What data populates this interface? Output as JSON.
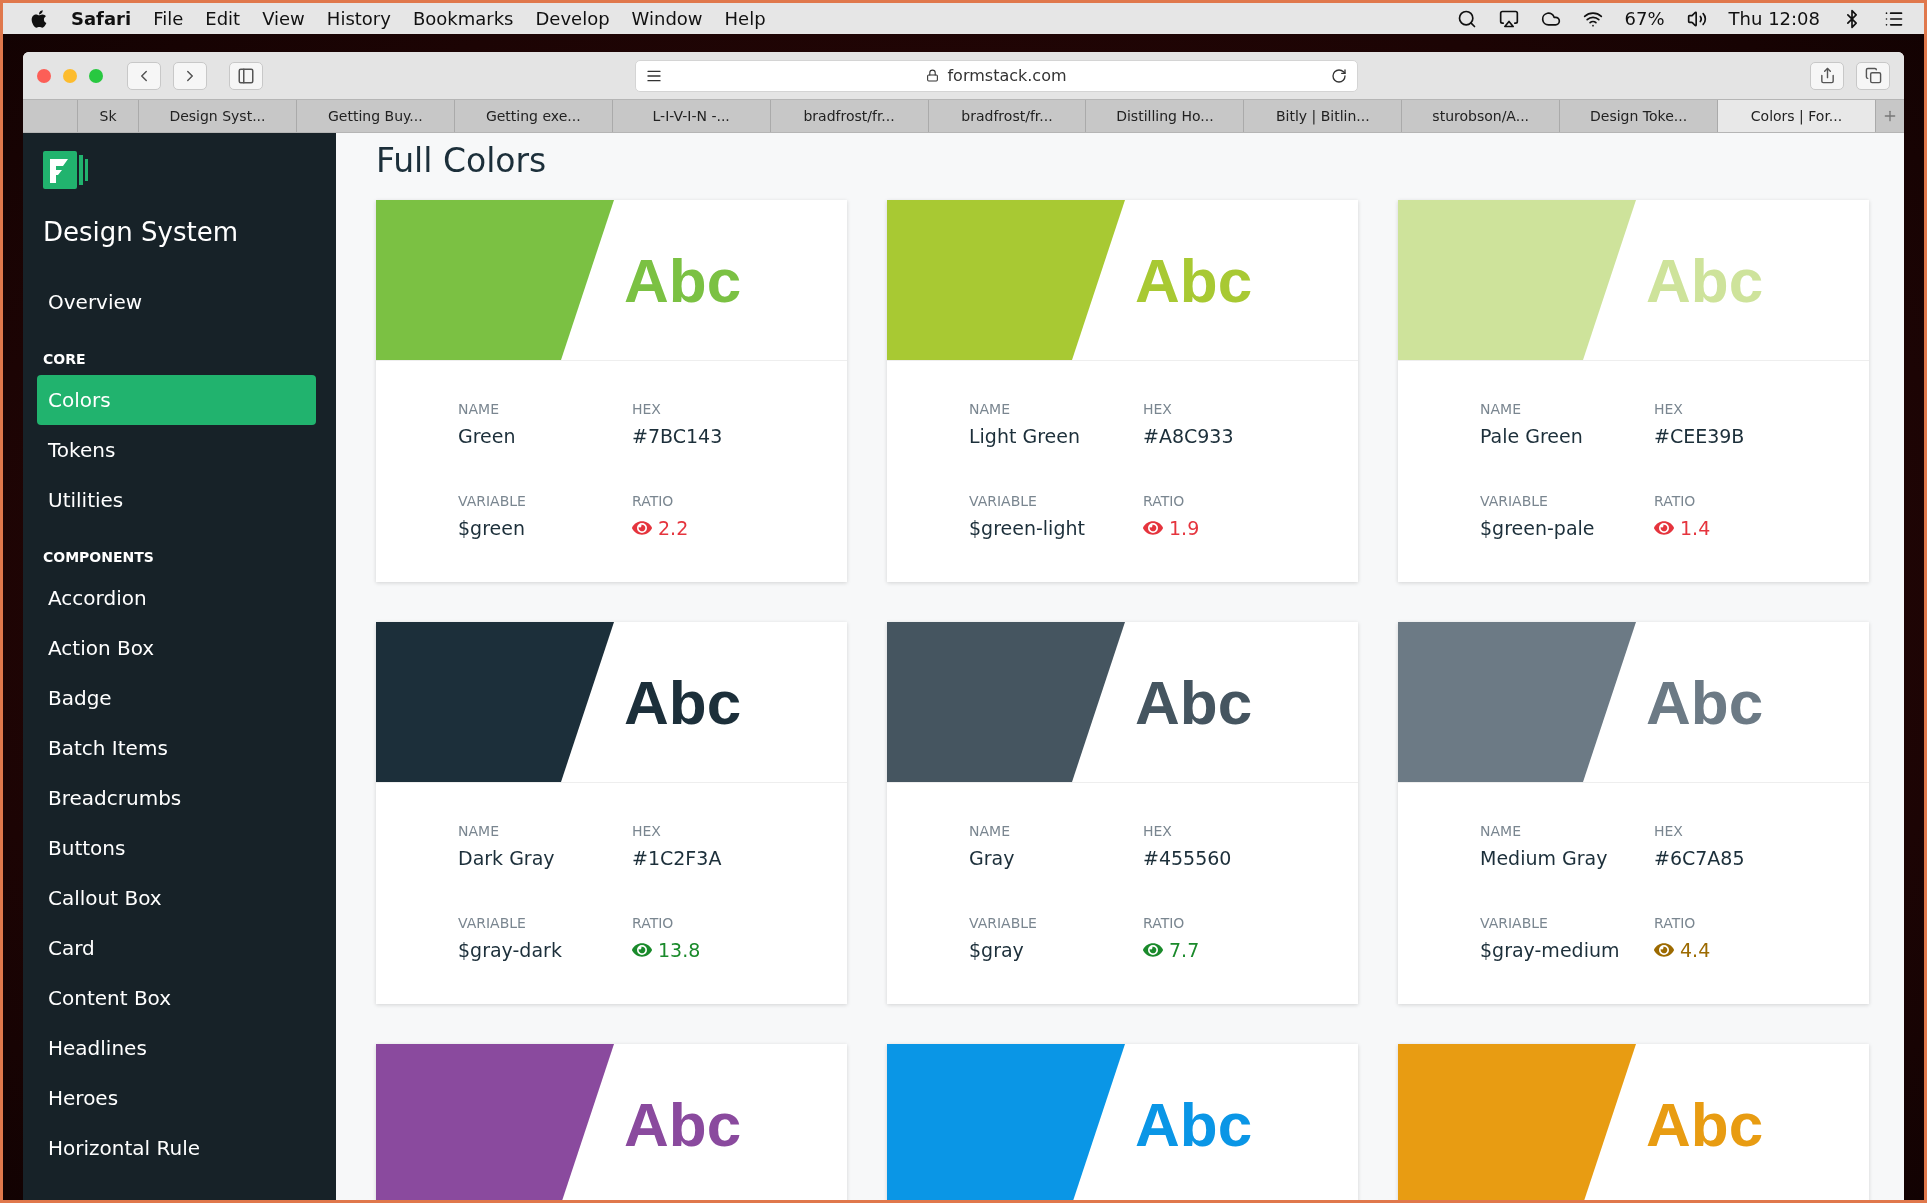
{
  "menubar": {
    "app": "Safari",
    "items": [
      "File",
      "Edit",
      "View",
      "History",
      "Bookmarks",
      "Develop",
      "Window",
      "Help"
    ],
    "battery": "67%",
    "clock": "Thu 12:08"
  },
  "browser": {
    "url": "formstack.com",
    "tabs": [
      {
        "label": "Sk",
        "selected": false
      },
      {
        "label": "Design Syst...",
        "selected": false
      },
      {
        "label": "Getting Buy...",
        "selected": false
      },
      {
        "label": "Getting exe...",
        "selected": false
      },
      {
        "label": "L-I-V-I-N -...",
        "selected": false
      },
      {
        "label": "bradfrost/fr...",
        "selected": false
      },
      {
        "label": "bradfrost/fr...",
        "selected": false
      },
      {
        "label": "Distilling Ho...",
        "selected": false
      },
      {
        "label": "Bitly | Bitlin...",
        "selected": false
      },
      {
        "label": "sturobson/A...",
        "selected": false
      },
      {
        "label": "Design Toke...",
        "selected": false
      },
      {
        "label": "Colors | For...",
        "selected": true
      }
    ]
  },
  "sidebar": {
    "title": "Design System",
    "sections": [
      {
        "items": [
          {
            "label": "Overview",
            "selected": false
          }
        ]
      },
      {
        "heading": "CORE",
        "items": [
          {
            "label": "Colors",
            "selected": true
          },
          {
            "label": "Tokens",
            "selected": false
          },
          {
            "label": "Utilities",
            "selected": false
          }
        ]
      },
      {
        "heading": "COMPONENTS",
        "items": [
          {
            "label": "Accordion",
            "selected": false
          },
          {
            "label": "Action Box",
            "selected": false
          },
          {
            "label": "Badge",
            "selected": false
          },
          {
            "label": "Batch Items",
            "selected": false
          },
          {
            "label": "Breadcrumbs",
            "selected": false
          },
          {
            "label": "Buttons",
            "selected": false
          },
          {
            "label": "Callout Box",
            "selected": false
          },
          {
            "label": "Card",
            "selected": false
          },
          {
            "label": "Content Box",
            "selected": false
          },
          {
            "label": "Headlines",
            "selected": false
          },
          {
            "label": "Heroes",
            "selected": false
          },
          {
            "label": "Horizontal Rule",
            "selected": false
          }
        ]
      }
    ]
  },
  "page": {
    "title": "Full Colors",
    "cards": [
      {
        "color": "#7bc143",
        "sample": "Abc",
        "name_label": "NAME",
        "name": "Green",
        "hex_label": "HEX",
        "hex": "#7BC143",
        "variable_label": "VARIABLE",
        "variable": "$green",
        "ratio_label": "RATIO",
        "ratio": {
          "value": "2.2",
          "color": "#e5343d"
        }
      },
      {
        "color": "#a8c933",
        "sample": "Abc",
        "name_label": "NAME",
        "name": "Light Green",
        "hex_label": "HEX",
        "hex": "#A8C933",
        "variable_label": "VARIABLE",
        "variable": "$green-light",
        "ratio_label": "RATIO",
        "ratio": {
          "value": "1.9",
          "color": "#e5343d"
        }
      },
      {
        "color": "#cee39b",
        "sample": "Abc",
        "name_label": "NAME",
        "name": "Pale Green",
        "hex_label": "HEX",
        "hex": "#CEE39B",
        "variable_label": "VARIABLE",
        "variable": "$green-pale",
        "ratio_label": "RATIO",
        "ratio": {
          "value": "1.4",
          "color": "#e5343d"
        }
      },
      {
        "color": "#1c2f3a",
        "sample": "Abc",
        "name_label": "NAME",
        "name": "Dark Gray",
        "hex_label": "HEX",
        "hex": "#1C2F3A",
        "variable_label": "VARIABLE",
        "variable": "$gray-dark",
        "ratio_label": "RATIO",
        "ratio": {
          "value": "13.8",
          "color": "#1a8a2b"
        }
      },
      {
        "color": "#455560",
        "sample": "Abc",
        "name_label": "NAME",
        "name": "Gray",
        "hex_label": "HEX",
        "hex": "#455560",
        "variable_label": "VARIABLE",
        "variable": "$gray",
        "ratio_label": "RATIO",
        "ratio": {
          "value": "7.7",
          "color": "#1a8a2b"
        }
      },
      {
        "color": "#6c7a85",
        "sample": "Abc",
        "name_label": "NAME",
        "name": "Medium Gray",
        "hex_label": "HEX",
        "hex": "#6C7A85",
        "variable_label": "VARIABLE",
        "variable": "$gray-medium",
        "ratio_label": "RATIO",
        "ratio": {
          "value": "4.4",
          "color": "#9c6a00"
        }
      },
      {
        "color": "#8a4a9e",
        "sample": "Abc"
      },
      {
        "color": "#0a96e6",
        "sample": "Abc"
      },
      {
        "color": "#e89c12",
        "sample": "Abc"
      }
    ]
  }
}
